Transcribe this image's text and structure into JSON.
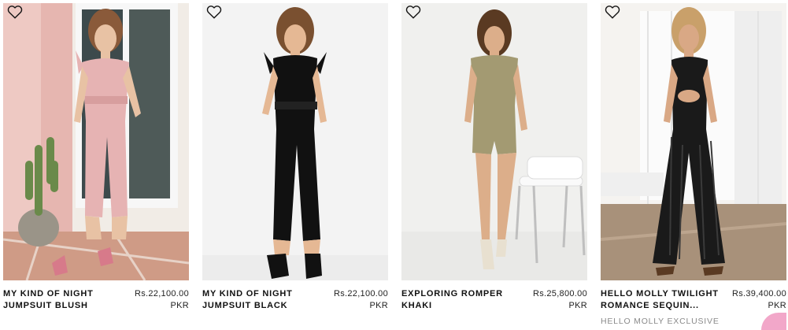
{
  "products": [
    {
      "title_line1": "MY KIND OF NIGHT",
      "title_line2": "JUMPSUIT BLUSH",
      "price": "Rs.22,100.00",
      "currency": "PKR",
      "wishlist_icon": "heart-outline-icon",
      "garment_color": "#e6b3b3"
    },
    {
      "title_line1": "MY KIND OF NIGHT",
      "title_line2": "JUMPSUIT BLACK",
      "price": "Rs.22,100.00",
      "currency": "PKR",
      "wishlist_icon": "heart-outline-icon",
      "garment_color": "#111111"
    },
    {
      "title_line1": "EXPLORING ROMPER",
      "title_line2": "KHAKI",
      "price": "Rs.25,800.00",
      "currency": "PKR",
      "wishlist_icon": "heart-outline-icon",
      "garment_color": "#a39a72"
    },
    {
      "title_line1": "HELLO MOLLY TWILIGHT",
      "title_line2": "ROMANCE SEQUIN...",
      "price": "Rs.39,400.00",
      "currency": "PKR",
      "badge": "HELLO MOLLY EXCLUSIVE",
      "wishlist_icon": "heart-outline-icon",
      "garment_color": "#1a1a1a"
    }
  ]
}
